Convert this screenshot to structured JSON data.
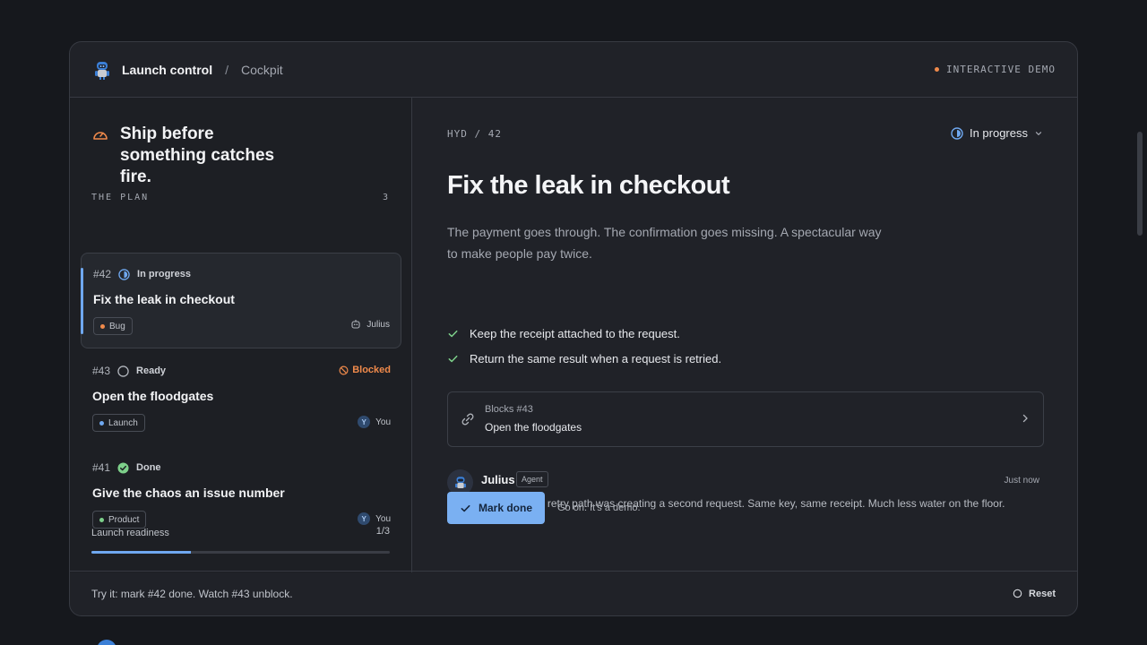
{
  "topbar": {
    "app_name": "Launch control",
    "separator": "/",
    "crumb": "Cockpit",
    "demo_tag": "INTERACTIVE DEMO"
  },
  "sidebar": {
    "title": "Ship before something catches fire.",
    "plan_label": "THE PLAN",
    "plan_count": "3",
    "cards": [
      {
        "num": "#42",
        "status": "In progress",
        "title": "Fix the leak in checkout",
        "tag": "Bug",
        "tag_color": "#f08a4b",
        "assignee": "Julius",
        "active": true
      },
      {
        "num": "#43",
        "status": "Ready",
        "title": "Open the floodgates",
        "tag": "Launch",
        "tag_color": "#6fa8f0",
        "assignee": "You",
        "avatar_initial": "Y",
        "blocked_label": "Blocked"
      },
      {
        "num": "#41",
        "status": "Done",
        "title": "Give the chaos an issue number",
        "tag": "Product",
        "tag_color": "#7dd08a",
        "assignee": "You",
        "avatar_initial": "Y"
      }
    ],
    "readiness": {
      "label": "Launch readiness",
      "count": "1/3",
      "progress": 0.333
    }
  },
  "main": {
    "id_line": "HYD / 42",
    "status": "In progress",
    "title": "Fix the leak in checkout",
    "description": "The payment goes through. The confirmation goes missing. A spectacular way to make people pay twice.",
    "checklist": [
      "Keep the receipt attached to the request.",
      "Return the same result when a request is retried."
    ],
    "blocks": {
      "label": "Blocks #43",
      "title": "Open the floodgates"
    },
    "comment": {
      "author": "Julius",
      "badge": "Agent",
      "time": "Just now",
      "text": "Found it. The retry path was creating a second request. Same key, same receipt. Much less water on the floor."
    },
    "mark_done_label": "Mark done",
    "hint": "Go on. It's a demo."
  },
  "footer": {
    "text": "Try it: mark #42 done. Watch #43 unblock.",
    "reset_label": "Reset"
  },
  "colors": {
    "accent": "#7ab0f2",
    "warning": "#f08a4b",
    "success": "#7dd08a"
  }
}
